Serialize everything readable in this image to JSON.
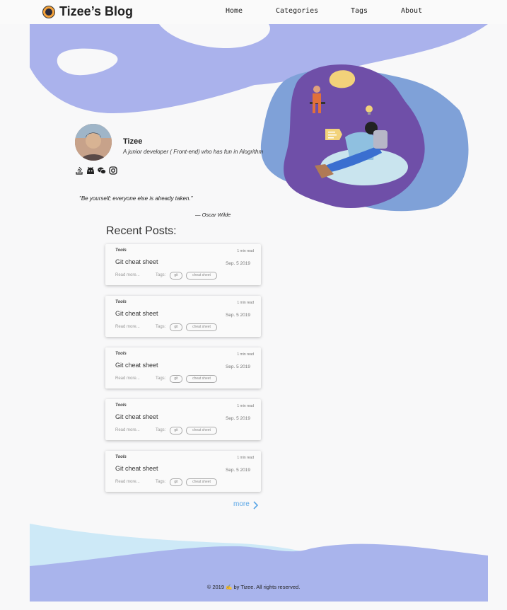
{
  "header": {
    "site_title": "Tizee’s Blog",
    "nav": [
      {
        "label": "Home"
      },
      {
        "label": "Categories"
      },
      {
        "label": "Tags"
      },
      {
        "label": "About"
      }
    ]
  },
  "profile": {
    "name": "Tizee",
    "description": "A junior developer ( Front-end) who has fun in Alogrithm",
    "socials": [
      "stackoverflow-icon",
      "github-icon",
      "wechat-icon",
      "instagram-icon"
    ]
  },
  "quote": {
    "text": "\"Be yourself; everyone else is already taken.\"",
    "author": "— Oscar Wilde"
  },
  "recent": {
    "title": "Recent Posts:",
    "posts": [
      {
        "category": "Tools",
        "read_time": "1 min  read",
        "title": "Git cheat sheet",
        "date": "Sep. 5  2019",
        "read_more": "Read more...",
        "tags_label": "Tags:",
        "tags": [
          "git",
          "cheat sheet"
        ]
      },
      {
        "category": "Tools",
        "read_time": "1 min  read",
        "title": "Git cheat sheet",
        "date": "Sep. 5  2019",
        "read_more": "Read more...",
        "tags_label": "Tags:",
        "tags": [
          "git",
          "cheat sheet"
        ]
      },
      {
        "category": "Tools",
        "read_time": "1 min  read",
        "title": "Git cheat sheet",
        "date": "Sep. 5  2019",
        "read_more": "Read more...",
        "tags_label": "Tags:",
        "tags": [
          "git",
          "cheat sheet"
        ]
      },
      {
        "category": "Tools",
        "read_time": "1 min  read",
        "title": "Git cheat sheet",
        "date": "Sep. 5  2019",
        "read_more": "Read more...",
        "tags_label": "Tags:",
        "tags": [
          "git",
          "cheat sheet"
        ]
      },
      {
        "category": "Tools",
        "read_time": "1 min  read",
        "title": "Git cheat sheet",
        "date": "Sep. 5  2019",
        "read_more": "Read more...",
        "tags_label": "Tags:",
        "tags": [
          "git",
          "cheat sheet"
        ]
      }
    ],
    "more_label": "more"
  },
  "footer": {
    "text": "© 2019 ✍️ by Tizee. All rights reserved."
  },
  "colors": {
    "blob_light": "#aab2ec",
    "blob_purple": "#6f4fa8",
    "blob_blue": "#7fa1d8",
    "link": "#5aa6e6",
    "footer_wave_light": "#cde9f7",
    "footer_wave": "#a9b4ec"
  }
}
